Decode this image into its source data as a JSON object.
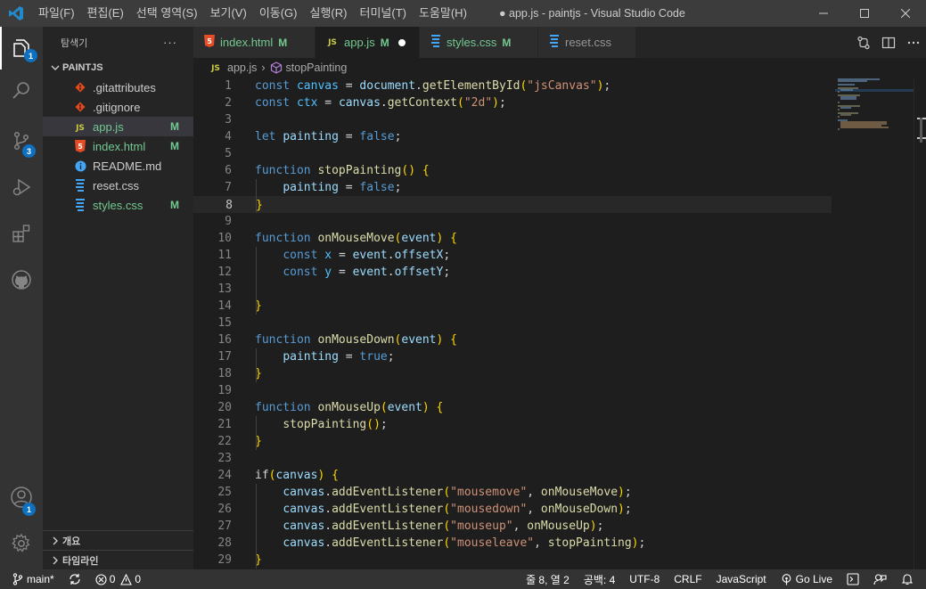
{
  "titlebar": {
    "menu": [
      "파일(F)",
      "편집(E)",
      "선택 영역(S)",
      "보기(V)",
      "이동(G)",
      "실행(R)",
      "터미널(T)",
      "도움말(H)"
    ],
    "title": "● app.js - paintjs - Visual Studio Code"
  },
  "activity": {
    "explorer_badge": "1",
    "scm_badge": "3",
    "account_badge": "1"
  },
  "sidebar": {
    "header": "탐색기",
    "more": "···",
    "folder": "PAINTJS",
    "files": [
      {
        "name": ".gitattributes",
        "icon": "git-icon",
        "badge": "",
        "color": "#cccccc"
      },
      {
        "name": ".gitignore",
        "icon": "git-icon",
        "badge": "",
        "color": "#cccccc"
      },
      {
        "name": "app.js",
        "icon": "js-icon",
        "badge": "M",
        "color": "#73c991"
      },
      {
        "name": "index.html",
        "icon": "html-icon",
        "badge": "M",
        "color": "#73c991"
      },
      {
        "name": "README.md",
        "icon": "info-icon",
        "badge": "",
        "color": "#cccccc"
      },
      {
        "name": "reset.css",
        "icon": "css-icon",
        "badge": "",
        "color": "#cccccc"
      },
      {
        "name": "styles.css",
        "icon": "css-icon",
        "badge": "M",
        "color": "#73c991"
      }
    ],
    "outline": "개요",
    "timeline": "타임라인"
  },
  "tabs": [
    {
      "label": "index.html",
      "badge": "M",
      "icon": "html-icon"
    },
    {
      "label": "app.js",
      "badge": "M",
      "icon": "js-icon"
    },
    {
      "label": "styles.css",
      "badge": "M",
      "icon": "css-icon"
    },
    {
      "label": "reset.css",
      "badge": "",
      "icon": "css-icon"
    }
  ],
  "breadcrumb": {
    "file": "app.js",
    "separator": "›",
    "symbol": "stopPainting"
  },
  "editor": {
    "current_line": 8,
    "lines": [
      "const canvas = document.getElementById(\"jsCanvas\");",
      "const ctx = canvas.getContext(\"2d\");",
      "",
      "let painting = false;",
      "",
      "function stopPainting() {",
      "    painting = false;",
      "}",
      "",
      "function onMouseMove(event) {",
      "    const x = event.offsetX;",
      "    const y = event.offsetY;",
      "",
      "}",
      "",
      "function onMouseDown(event) {",
      "    painting = true;",
      "}",
      "",
      "function onMouseUp(event) {",
      "    stopPainting();",
      "}",
      "",
      "if(canvas) {",
      "    canvas.addEventListener(\"mousemove\", onMouseMove);",
      "    canvas.addEventListener(\"mousedown\", onMouseDown);",
      "    canvas.addEventListener(\"mouseup\", onMouseUp);",
      "    canvas.addEventListener(\"mouseleave\", stopPainting);",
      "}"
    ]
  },
  "statusbar": {
    "branch": "main*",
    "errors": "0",
    "warnings": "0",
    "position": "줄 8, 열 2",
    "spaces": "공백: 4",
    "encoding": "UTF-8",
    "eol": "CRLF",
    "language": "JavaScript",
    "golive": "Go Live"
  },
  "colors": {
    "accent": "#0e70c0",
    "modified": "#73c991",
    "js": "#cbcb41",
    "html": "#e44d26",
    "css": "#42a5f5"
  }
}
